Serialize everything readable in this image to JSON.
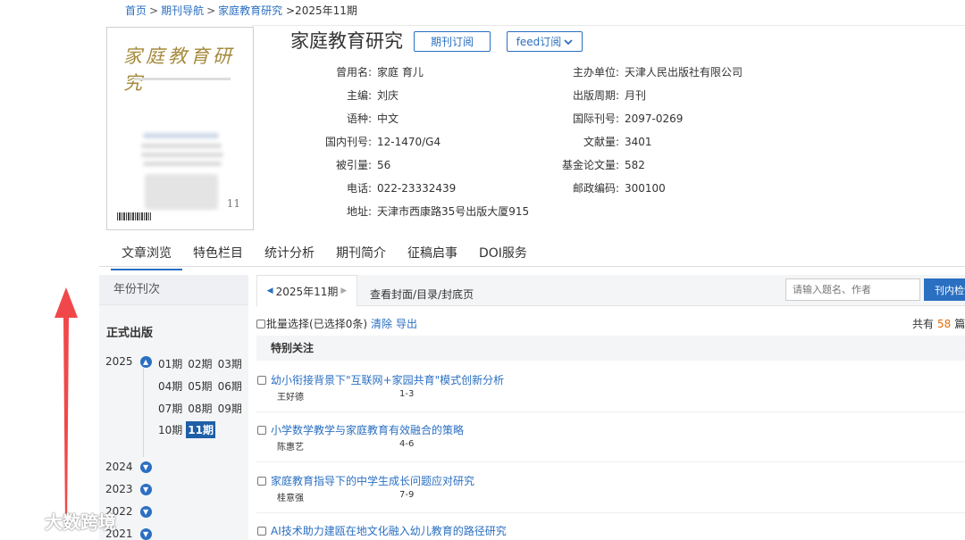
{
  "breadcrumb": {
    "home": "首页",
    "nav": "期刊导航",
    "journal": "家庭教育研究",
    "issue": ">2025年11期",
    "sep": ">"
  },
  "cover": {
    "logo_text": "家庭教育研究",
    "issue_no": "11"
  },
  "journal": {
    "title": "家庭教育研究",
    "subscribe": "期刊订阅",
    "feed": "feed订阅"
  },
  "info_left": [
    {
      "key": "曾用名:",
      "value": "家庭 育儿"
    },
    {
      "key": "主编:",
      "value": "刘庆"
    },
    {
      "key": "语种:",
      "value": "中文"
    },
    {
      "key": "国内刊号:",
      "value": "12-1470/G4"
    },
    {
      "key": "被引量:",
      "value": "56"
    },
    {
      "key": "电话:",
      "value": "022-23332439"
    },
    {
      "key": "地址:",
      "value": "天津市西康路35号出版大厦915"
    }
  ],
  "info_right": [
    {
      "key": "主办单位:",
      "value": "天津人民出版社有限公司"
    },
    {
      "key": "出版周期:",
      "value": "月刊"
    },
    {
      "key": "国际刊号:",
      "value": "2097-0269"
    },
    {
      "key": "文献量:",
      "value": "3401"
    },
    {
      "key": "基金论文量:",
      "value": "582"
    },
    {
      "key": "邮政编码:",
      "value": "300100"
    }
  ],
  "tabs": [
    "文章浏览",
    "特色栏目",
    "统计分析",
    "期刊简介",
    "征稿启事",
    "DOI服务"
  ],
  "sidebar": {
    "header": "年份刊次",
    "section": "正式出版",
    "year_current": "2025",
    "issues": [
      [
        "01期",
        "02期",
        "03期"
      ],
      [
        "04期",
        "05期",
        "06期"
      ],
      [
        "07期",
        "08期",
        "09期"
      ],
      [
        "10期",
        "11期"
      ]
    ],
    "years_collapsed": [
      "2024",
      "2023",
      "2022",
      "2021"
    ]
  },
  "toolbar": {
    "issue_label": "2025年11期",
    "cover_link": "查看封面/目录/封底页",
    "search_placeholder": "请输入题名、作者",
    "search_button": "刊内检索"
  },
  "batch": {
    "label": "批量选择",
    "selected": "(已选择0条)",
    "clear": "清除",
    "export": "导出"
  },
  "total": {
    "prefix": "共有",
    "count": "58",
    "suffix": "篇"
  },
  "section_title": "特别关注",
  "articles": [
    {
      "title": "幼小衔接背景下\"互联网+家园共育\"模式创新分析",
      "author": "王好德",
      "pages": "1-3"
    },
    {
      "title": "小学数学教学与家庭教育有效融合的策略",
      "author": "陈惠艺",
      "pages": "4-6"
    },
    {
      "title": "家庭教育指导下的中学生成长问题应对研究",
      "author": "桂意强",
      "pages": "7-9"
    },
    {
      "title": "AI技术助力建瓯在地文化融入幼儿教育的路径研究",
      "author": "",
      "pages": ""
    }
  ],
  "watermark": "大数跨境",
  "colors": {
    "accent": "#2a6fc2",
    "count": "#e36c0a",
    "arrow": "#f0484a"
  }
}
